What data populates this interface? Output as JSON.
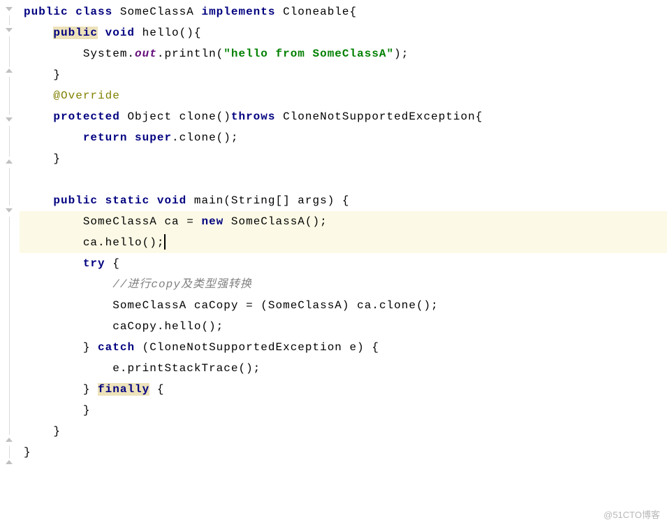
{
  "code": {
    "l1": {
      "kw_public": "public",
      "kw_class": "class",
      "class_name": "SomeClassA",
      "kw_implements": "implements",
      "iface": "Cloneable",
      "brace": "{"
    },
    "l2": {
      "kw_public": "public",
      "kw_void": "void",
      "method": "hello",
      "parens": "()",
      "brace": "{"
    },
    "l3": {
      "obj": "System",
      "dot1": ".",
      "field": "out",
      "dot2": ".",
      "method": "println",
      "open": "(",
      "str": "\"hello from SomeClassA\"",
      "close": ");"
    },
    "l4": {
      "brace": "}"
    },
    "l5": {
      "annot": "@Override"
    },
    "l6": {
      "kw_protected": "protected",
      "ret": "Object",
      "method": "clone",
      "parens": "()",
      "kw_throws": "throws",
      "ex": "CloneNotSupportedException",
      "brace": "{"
    },
    "l7": {
      "kw_return": "return",
      "kw_super": "super",
      "dot": ".",
      "method": "clone",
      "end": "();"
    },
    "l8": {
      "brace": "}"
    },
    "l9": {
      "blank": ""
    },
    "l10": {
      "kw_public": "public",
      "kw_static": "static",
      "kw_void": "void",
      "method": "main",
      "open": "(",
      "type": "String[]",
      "param": "args",
      "close": ")",
      "brace": "{"
    },
    "l11": {
      "type": "SomeClassA",
      "var": "ca",
      "eq": "=",
      "kw_new": "new",
      "ctor": "SomeClassA",
      "end": "();"
    },
    "l12": {
      "var": "ca",
      "dot": ".",
      "method": "hello",
      "end": "();"
    },
    "l13": {
      "kw_try": "try",
      "brace": "{"
    },
    "l14": {
      "comment": "//进行copy及类型强转换"
    },
    "l15": {
      "type": "SomeClassA",
      "var": "caCopy",
      "eq": "=",
      "cast_open": "(",
      "cast_type": "SomeClassA",
      "cast_close": ")",
      "obj": "ca",
      "dot": ".",
      "method": "clone",
      "end": "();"
    },
    "l16": {
      "var": "caCopy",
      "dot": ".",
      "method": "hello",
      "end": "();"
    },
    "l17": {
      "close_brace": "}",
      "kw_catch": "catch",
      "open": "(",
      "ex_type": "CloneNotSupportedException",
      "ex_var": "e",
      "close": ")",
      "brace": "{"
    },
    "l18": {
      "var": "e",
      "dot": ".",
      "method": "printStackTrace",
      "end": "();"
    },
    "l19": {
      "close_brace": "}",
      "kw_finally": "finally",
      "brace": "{"
    },
    "l20": {
      "brace": "}"
    },
    "l21": {
      "brace": "}"
    },
    "l22": {
      "brace": "}"
    }
  },
  "watermark": "@51CTO博客"
}
